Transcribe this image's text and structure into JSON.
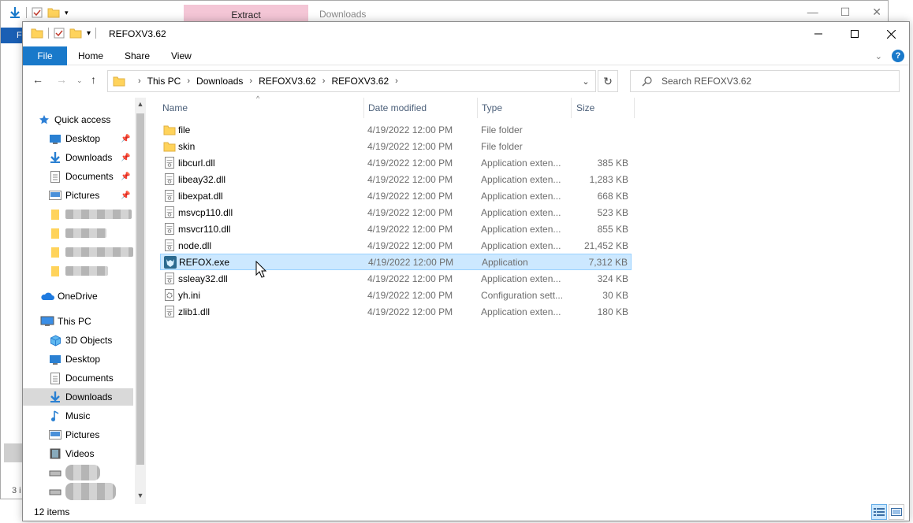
{
  "background_window": {
    "extract_tab": "Extract",
    "title": "Downloads",
    "file_tab": "F",
    "status": "3 i"
  },
  "window": {
    "title": "REFOXV3.62",
    "minimize_icon": "minimize-icon",
    "maximize_icon": "maximize-icon",
    "close_icon": "close-icon"
  },
  "ribbon": {
    "tabs": [
      "File",
      "Home",
      "Share",
      "View"
    ],
    "help": "?"
  },
  "address": {
    "crumbs": [
      "This PC",
      "Downloads",
      "REFOXV3.62",
      "REFOXV3.62"
    ]
  },
  "search": {
    "placeholder": "Search REFOXV3.62"
  },
  "nav": {
    "quick_access": "Quick access",
    "quick_items": [
      "Desktop",
      "Downloads",
      "Documents",
      "Pictures"
    ],
    "onedrive": "OneDrive",
    "this_pc": "This PC",
    "pc_items": [
      "3D Objects",
      "Desktop",
      "Documents",
      "Downloads",
      "Music",
      "Pictures",
      "Videos"
    ]
  },
  "columns": {
    "name": "Name",
    "date": "Date modified",
    "type": "Type",
    "size": "Size"
  },
  "files": [
    {
      "name": "file",
      "date": "4/19/2022 12:00 PM",
      "type": "File folder",
      "size": "",
      "icon": "folder-icon"
    },
    {
      "name": "skin",
      "date": "4/19/2022 12:00 PM",
      "type": "File folder",
      "size": "",
      "icon": "folder-icon"
    },
    {
      "name": "libcurl.dll",
      "date": "4/19/2022 12:00 PM",
      "type": "Application exten...",
      "size": "385 KB",
      "icon": "dll-icon"
    },
    {
      "name": "libeay32.dll",
      "date": "4/19/2022 12:00 PM",
      "type": "Application exten...",
      "size": "1,283 KB",
      "icon": "dll-icon"
    },
    {
      "name": "libexpat.dll",
      "date": "4/19/2022 12:00 PM",
      "type": "Application exten...",
      "size": "668 KB",
      "icon": "dll-icon"
    },
    {
      "name": "msvcp110.dll",
      "date": "4/19/2022 12:00 PM",
      "type": "Application exten...",
      "size": "523 KB",
      "icon": "dll-icon"
    },
    {
      "name": "msvcr110.dll",
      "date": "4/19/2022 12:00 PM",
      "type": "Application exten...",
      "size": "855 KB",
      "icon": "dll-icon"
    },
    {
      "name": "node.dll",
      "date": "4/19/2022 12:00 PM",
      "type": "Application exten...",
      "size": "21,452 KB",
      "icon": "dll-icon"
    },
    {
      "name": "REFOX.exe",
      "date": "4/19/2022 12:00 PM",
      "type": "Application",
      "size": "7,312 KB",
      "icon": "refox-app-icon",
      "selected": true
    },
    {
      "name": "ssleay32.dll",
      "date": "4/19/2022 12:00 PM",
      "type": "Application exten...",
      "size": "324 KB",
      "icon": "dll-icon"
    },
    {
      "name": "yh.ini",
      "date": "4/19/2022 12:00 PM",
      "type": "Configuration sett...",
      "size": "30 KB",
      "icon": "ini-icon"
    },
    {
      "name": "zlib1.dll",
      "date": "4/19/2022 12:00 PM",
      "type": "Application exten...",
      "size": "180 KB",
      "icon": "dll-icon"
    }
  ],
  "status": {
    "item_count": "12 items"
  },
  "colors": {
    "accent": "#1979ca",
    "selection": "#cce8ff",
    "folder": "#ffd35b"
  }
}
